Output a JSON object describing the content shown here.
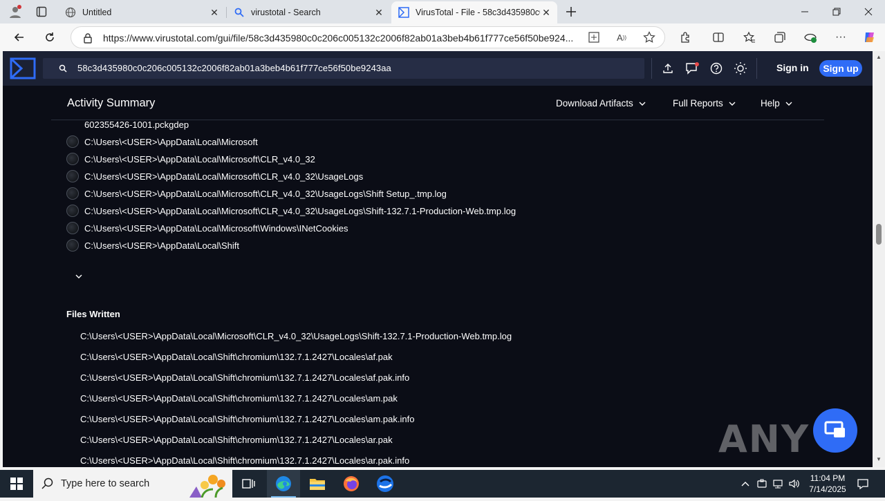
{
  "browser": {
    "tabs": [
      {
        "title": "Untitled",
        "icon": "globe-icon"
      },
      {
        "title": "virustotal - Search",
        "icon": "search-icon"
      },
      {
        "title": "VirusTotal - File - 58c3d435980c0",
        "icon": "virustotal-icon",
        "active": true
      }
    ],
    "address": "https://www.virustotal.com/gui/file/58c3d435980c0c206c005132c2006f82ab01a3beb4b61f777ce56f50be924..."
  },
  "vt": {
    "search_value": "58c3d435980c0c206c005132c2006f82ab01a3beb4b61f777ce56f50be9243aa",
    "sign_in": "Sign in",
    "sign_up": "Sign up",
    "activity_title": "Activity Summary",
    "menus": [
      "Download Artifacts",
      "Full Reports",
      "Help"
    ],
    "directories": [
      "602355426-1001.pckgdep",
      "C:\\Users\\<USER>\\AppData\\Local\\Microsoft",
      "C:\\Users\\<USER>\\AppData\\Local\\Microsoft\\CLR_v4.0_32",
      "C:\\Users\\<USER>\\AppData\\Local\\Microsoft\\CLR_v4.0_32\\UsageLogs",
      "C:\\Users\\<USER>\\AppData\\Local\\Microsoft\\CLR_v4.0_32\\UsageLogs\\Shift Setup_.tmp.log",
      "C:\\Users\\<USER>\\AppData\\Local\\Microsoft\\CLR_v4.0_32\\UsageLogs\\Shift-132.7.1-Production-Web.tmp.log",
      "C:\\Users\\<USER>\\AppData\\Local\\Microsoft\\Windows\\INetCookies",
      "C:\\Users\\<USER>\\AppData\\Local\\Shift"
    ],
    "files_written_title": "Files Written",
    "files_written": [
      "C:\\Users\\<USER>\\AppData\\Local\\Microsoft\\CLR_v4.0_32\\UsageLogs\\Shift-132.7.1-Production-Web.tmp.log",
      "C:\\Users\\<USER>\\AppData\\Local\\Shift\\chromium\\132.7.1.2427\\Locales\\af.pak",
      "C:\\Users\\<USER>\\AppData\\Local\\Shift\\chromium\\132.7.1.2427\\Locales\\af.pak.info",
      "C:\\Users\\<USER>\\AppData\\Local\\Shift\\chromium\\132.7.1.2427\\Locales\\am.pak",
      "C:\\Users\\<USER>\\AppData\\Local\\Shift\\chromium\\132.7.1.2427\\Locales\\am.pak.info",
      "C:\\Users\\<USER>\\AppData\\Local\\Shift\\chromium\\132.7.1.2427\\Locales\\ar.pak",
      "C:\\Users\\<USER>\\AppData\\Local\\Shift\\chromium\\132.7.1.2427\\Locales\\ar.pak.info"
    ]
  },
  "watermark": "ANY RUN",
  "taskbar": {
    "search_placeholder": "Type here to search",
    "time": "11:04 PM",
    "date": "7/14/2025"
  },
  "colors": {
    "vt_header": "#1b2134",
    "vt_background": "#0b0d16",
    "accent_blue": "#2f6cf6"
  }
}
